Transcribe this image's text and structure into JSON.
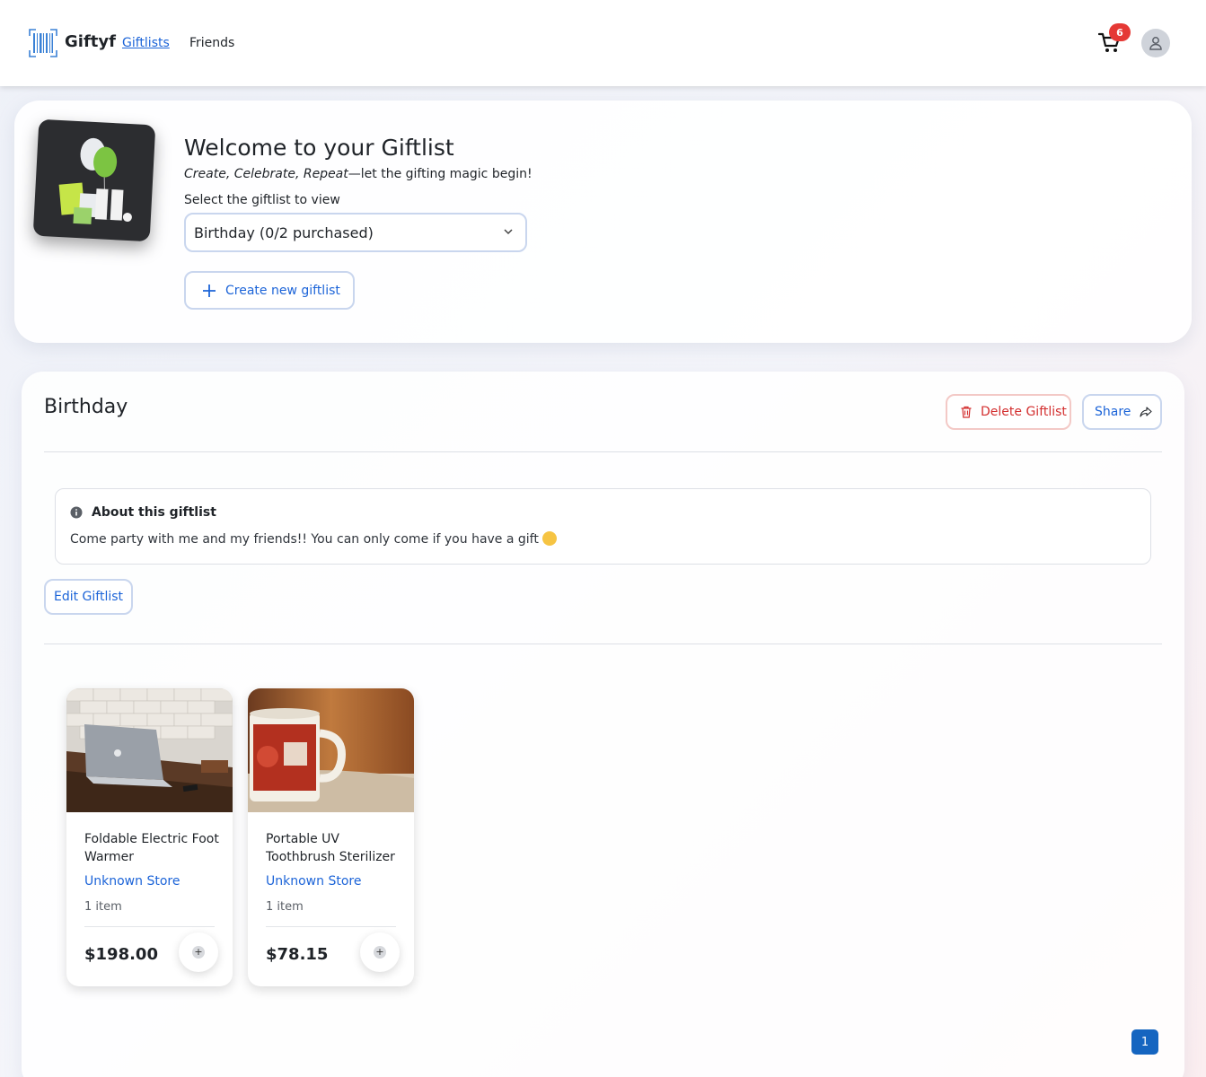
{
  "header": {
    "brand": "Giftyf",
    "nav": [
      {
        "label": "Giftlists",
        "active": true
      },
      {
        "label": "Friends",
        "active": false
      }
    ],
    "cart_count": "6",
    "accent": "#1c64d8",
    "badge_color": "#e53935"
  },
  "welcome": {
    "title": "Welcome to your Giftlist",
    "subtitle_italic": "Create, Celebrate, Repeat",
    "subtitle_rest": "—let the gifting magic begin!",
    "select_label": "Select the giftlist to view",
    "selected_giftlist": "Birthday (0/2 purchased)",
    "create_button": "Create new giftlist"
  },
  "giftlist": {
    "name": "Birthday",
    "delete_button": "Delete Giftlist",
    "share_button": "Share",
    "about_title": "About this giftlist",
    "about_text": "Come party with me and my friends!! You can only come if you have a gift",
    "edit_button": "Edit Giftlist",
    "items": [
      {
        "name": "Foldable Electric Foot Warmer",
        "store": "Unknown Store",
        "quantity": "1 item",
        "price": "$198.00"
      },
      {
        "name": "Portable UV Toothbrush Sterilizer",
        "store": "Unknown Store",
        "quantity": "1 item",
        "price": "$78.15"
      }
    ],
    "current_page": "1"
  }
}
